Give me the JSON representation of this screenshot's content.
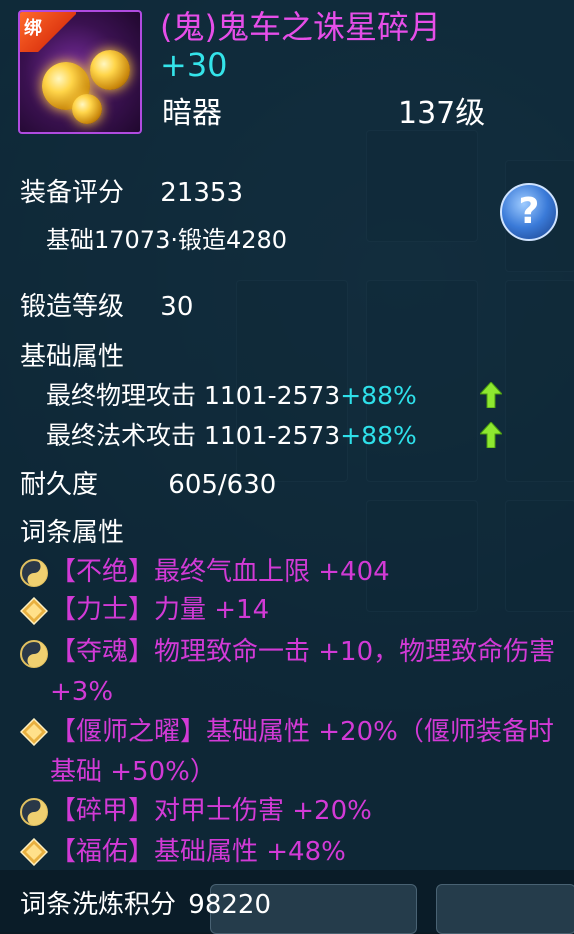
{
  "item": {
    "bind_tag": "绑",
    "name": "(鬼)鬼车之诛星碎月",
    "enhance": "+30",
    "type": "暗器",
    "level": "137级"
  },
  "score": {
    "label": "装备评分",
    "value": "21353",
    "breakdown": "基础17073·锻造4280"
  },
  "forge": {
    "label": "锻造等级",
    "value": "30"
  },
  "base_attrs": {
    "label": "基础属性",
    "items": [
      {
        "name": "最终物理攻击 1101-2573",
        "bonus": "+88%"
      },
      {
        "name": "最终法术攻击 1101-2573",
        "bonus": "+88%"
      }
    ]
  },
  "durability": {
    "label": "耐久度",
    "value": "605/630"
  },
  "affixes": {
    "label": "词条属性",
    "items": [
      {
        "icon": "yinyang-icon",
        "text": "【不绝】最终气血上限 +404"
      },
      {
        "icon": "diamond-icon",
        "text": "【力士】力量 +14"
      },
      {
        "icon": "yinyang-icon",
        "text": "【夺魂】物理致命一击 +10，物理致命伤害 +3%"
      },
      {
        "icon": "diamond-icon",
        "text": "【偃师之曜】基础属性 +20%（偃师装备时基础 +50%）"
      },
      {
        "icon": "yinyang-icon",
        "text": "【碎甲】对甲士伤害 +20%"
      },
      {
        "icon": "diamond-icon",
        "text": "【福佑】基础属性 +48%"
      }
    ]
  },
  "refine": {
    "label": "词条洗炼积分",
    "value": "98220"
  },
  "help_symbol": "?"
}
